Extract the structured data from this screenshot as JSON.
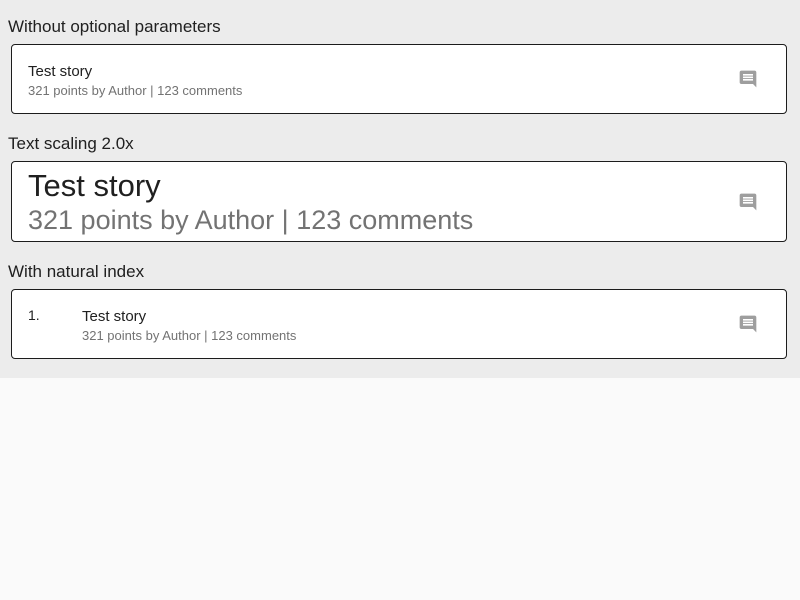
{
  "sections": [
    {
      "label": "Without optional parameters",
      "story": {
        "title": "Test story",
        "subtitle": "321 points by Author | 123 comments"
      }
    },
    {
      "label": "Text scaling 2.0x",
      "story": {
        "title": "Test story",
        "subtitle": "321 points by Author | 123 comments"
      }
    },
    {
      "label": "With natural index",
      "story": {
        "index": "1.",
        "title": "Test story",
        "subtitle": "321 points by Author | 123 comments"
      }
    }
  ],
  "icons": {
    "comment": "comment-icon"
  },
  "colors": {
    "panel_background": "#ececec",
    "page_background": "#fafafa",
    "card_border": "#1c1c1c",
    "title_text": "#202020",
    "subtitle_text": "#737373",
    "icon": "#9e9e9e"
  }
}
